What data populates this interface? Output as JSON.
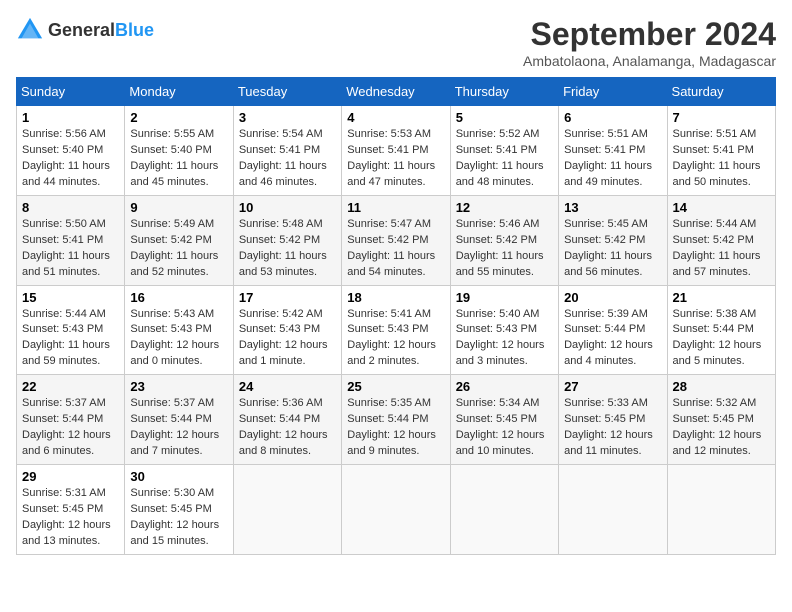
{
  "header": {
    "logo_general": "General",
    "logo_blue": "Blue",
    "month_year": "September 2024",
    "location": "Ambatolaona, Analamanga, Madagascar"
  },
  "weekdays": [
    "Sunday",
    "Monday",
    "Tuesday",
    "Wednesday",
    "Thursday",
    "Friday",
    "Saturday"
  ],
  "weeks": [
    [
      {
        "day": "1",
        "sunrise": "5:56 AM",
        "sunset": "5:40 PM",
        "daylight": "11 hours and 44 minutes."
      },
      {
        "day": "2",
        "sunrise": "5:55 AM",
        "sunset": "5:40 PM",
        "daylight": "11 hours and 45 minutes."
      },
      {
        "day": "3",
        "sunrise": "5:54 AM",
        "sunset": "5:41 PM",
        "daylight": "11 hours and 46 minutes."
      },
      {
        "day": "4",
        "sunrise": "5:53 AM",
        "sunset": "5:41 PM",
        "daylight": "11 hours and 47 minutes."
      },
      {
        "day": "5",
        "sunrise": "5:52 AM",
        "sunset": "5:41 PM",
        "daylight": "11 hours and 48 minutes."
      },
      {
        "day": "6",
        "sunrise": "5:51 AM",
        "sunset": "5:41 PM",
        "daylight": "11 hours and 49 minutes."
      },
      {
        "day": "7",
        "sunrise": "5:51 AM",
        "sunset": "5:41 PM",
        "daylight": "11 hours and 50 minutes."
      }
    ],
    [
      {
        "day": "8",
        "sunrise": "5:50 AM",
        "sunset": "5:41 PM",
        "daylight": "11 hours and 51 minutes."
      },
      {
        "day": "9",
        "sunrise": "5:49 AM",
        "sunset": "5:42 PM",
        "daylight": "11 hours and 52 minutes."
      },
      {
        "day": "10",
        "sunrise": "5:48 AM",
        "sunset": "5:42 PM",
        "daylight": "11 hours and 53 minutes."
      },
      {
        "day": "11",
        "sunrise": "5:47 AM",
        "sunset": "5:42 PM",
        "daylight": "11 hours and 54 minutes."
      },
      {
        "day": "12",
        "sunrise": "5:46 AM",
        "sunset": "5:42 PM",
        "daylight": "11 hours and 55 minutes."
      },
      {
        "day": "13",
        "sunrise": "5:45 AM",
        "sunset": "5:42 PM",
        "daylight": "11 hours and 56 minutes."
      },
      {
        "day": "14",
        "sunrise": "5:44 AM",
        "sunset": "5:42 PM",
        "daylight": "11 hours and 57 minutes."
      }
    ],
    [
      {
        "day": "15",
        "sunrise": "5:44 AM",
        "sunset": "5:43 PM",
        "daylight": "11 hours and 59 minutes."
      },
      {
        "day": "16",
        "sunrise": "5:43 AM",
        "sunset": "5:43 PM",
        "daylight": "12 hours and 0 minutes."
      },
      {
        "day": "17",
        "sunrise": "5:42 AM",
        "sunset": "5:43 PM",
        "daylight": "12 hours and 1 minute."
      },
      {
        "day": "18",
        "sunrise": "5:41 AM",
        "sunset": "5:43 PM",
        "daylight": "12 hours and 2 minutes."
      },
      {
        "day": "19",
        "sunrise": "5:40 AM",
        "sunset": "5:43 PM",
        "daylight": "12 hours and 3 minutes."
      },
      {
        "day": "20",
        "sunrise": "5:39 AM",
        "sunset": "5:44 PM",
        "daylight": "12 hours and 4 minutes."
      },
      {
        "day": "21",
        "sunrise": "5:38 AM",
        "sunset": "5:44 PM",
        "daylight": "12 hours and 5 minutes."
      }
    ],
    [
      {
        "day": "22",
        "sunrise": "5:37 AM",
        "sunset": "5:44 PM",
        "daylight": "12 hours and 6 minutes."
      },
      {
        "day": "23",
        "sunrise": "5:37 AM",
        "sunset": "5:44 PM",
        "daylight": "12 hours and 7 minutes."
      },
      {
        "day": "24",
        "sunrise": "5:36 AM",
        "sunset": "5:44 PM",
        "daylight": "12 hours and 8 minutes."
      },
      {
        "day": "25",
        "sunrise": "5:35 AM",
        "sunset": "5:44 PM",
        "daylight": "12 hours and 9 minutes."
      },
      {
        "day": "26",
        "sunrise": "5:34 AM",
        "sunset": "5:45 PM",
        "daylight": "12 hours and 10 minutes."
      },
      {
        "day": "27",
        "sunrise": "5:33 AM",
        "sunset": "5:45 PM",
        "daylight": "12 hours and 11 minutes."
      },
      {
        "day": "28",
        "sunrise": "5:32 AM",
        "sunset": "5:45 PM",
        "daylight": "12 hours and 12 minutes."
      }
    ],
    [
      {
        "day": "29",
        "sunrise": "5:31 AM",
        "sunset": "5:45 PM",
        "daylight": "12 hours and 13 minutes."
      },
      {
        "day": "30",
        "sunrise": "5:30 AM",
        "sunset": "5:45 PM",
        "daylight": "12 hours and 15 minutes."
      },
      null,
      null,
      null,
      null,
      null
    ]
  ]
}
